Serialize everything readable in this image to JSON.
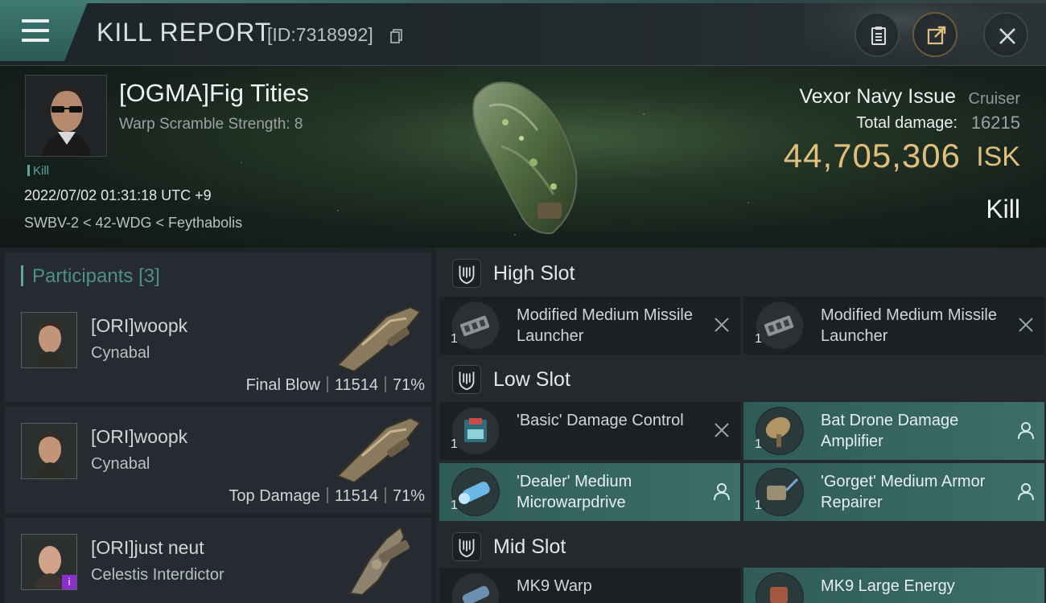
{
  "header": {
    "title": "KILL REPORT",
    "id_text": "[ID:7318992]"
  },
  "victim": {
    "name": "[OGMA]Fig Tities",
    "subtitle": "Warp Scramble Strength: 8",
    "tag": "Kill",
    "datetime": "2022/07/02 01:31:18 UTC +9",
    "location": "SWBV-2 < 42-WDG < Feythabolis",
    "ship_name": "Vexor Navy Issue",
    "ship_class": "Cruiser",
    "total_damage_label": "Total damage:",
    "total_damage": "16215",
    "isk_value": "44,705,306",
    "isk_unit": "ISK",
    "result": "Kill"
  },
  "participants": {
    "title": "Participants",
    "count": "[3]",
    "rows": [
      {
        "name": "[ORI]woopk",
        "ship": "Cynabal",
        "role": "Final Blow",
        "damage": "11514",
        "percent": "71%"
      },
      {
        "name": "[ORI]woopk",
        "ship": "Cynabal",
        "role": "Top Damage",
        "damage": "11514",
        "percent": "71%"
      },
      {
        "name": "[ORI]just neut",
        "ship": "Celestis Interdictor",
        "role": "",
        "damage": "",
        "percent": ""
      }
    ]
  },
  "fittings": {
    "high": {
      "label": "High Slot",
      "modules": [
        {
          "qty": "1",
          "name": "Modified Medium Missile Launcher",
          "status": "destroyed"
        },
        {
          "qty": "1",
          "name": "Modified Medium Missile Launcher",
          "status": "destroyed"
        }
      ]
    },
    "low": {
      "label": "Low Slot",
      "modules": [
        {
          "qty": "1",
          "name": "'Basic' Damage Control",
          "status": "destroyed"
        },
        {
          "qty": "1",
          "name": "Bat Drone Damage Amplifier",
          "status": "dropped"
        },
        {
          "qty": "1",
          "name": "'Dealer' Medium Microwarpdrive",
          "status": "dropped"
        },
        {
          "qty": "1",
          "name": "'Gorget' Medium Armor Repairer",
          "status": "dropped"
        }
      ]
    },
    "mid": {
      "label": "Mid Slot",
      "modules": [
        {
          "qty": "",
          "name": "MK9 Warp",
          "status": "destroyed"
        },
        {
          "qty": "",
          "name": "MK9 Large Energy",
          "status": "dropped"
        }
      ]
    }
  },
  "colors": {
    "accent_teal": "#5fa6a0",
    "isk_gold": "#e0bf7c",
    "dropped_bg": "#3d6e69"
  },
  "icons": [
    "menu-icon",
    "copy-icon",
    "clipboard-icon",
    "share-icon",
    "close-icon",
    "shield-slot-icon",
    "destroyed-x-icon",
    "person-icon"
  ]
}
